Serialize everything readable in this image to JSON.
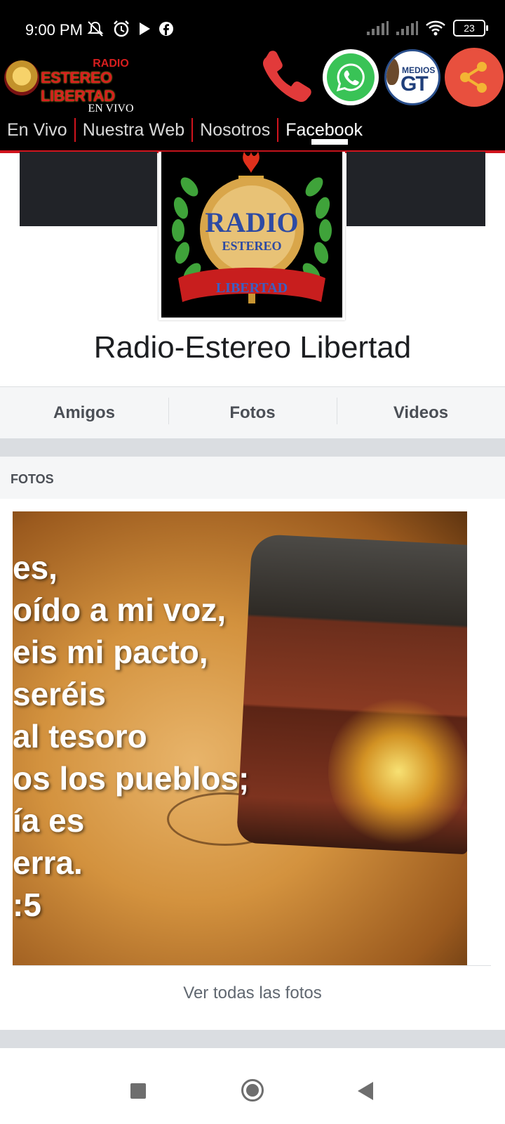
{
  "status_bar": {
    "time": "9:00 PM",
    "battery": "23",
    "icons": [
      "mute-bell-icon",
      "alarm-icon",
      "play-icon",
      "facebook-icon",
      "signal-icon",
      "signal-icon",
      "wifi-icon",
      "battery-icon"
    ]
  },
  "header": {
    "logo": {
      "line1": "RADIO",
      "line2": "ESTEREO LIBERTAD",
      "line3": "EN VIVO"
    },
    "actions": {
      "phone": "phone-icon",
      "whatsapp": "whatsapp-icon",
      "medios_gt": {
        "top": "MEDIOS",
        "main": "GT"
      },
      "share": "share-icon"
    },
    "tabs": [
      {
        "label": "En Vivo"
      },
      {
        "label": "Nuestra Web"
      },
      {
        "label": "Nosotros"
      },
      {
        "label": "Facebook",
        "active": true
      }
    ]
  },
  "profile": {
    "picture_text": {
      "main": "RADIO",
      "sub": "ESTEREO",
      "ribbon": "LIBERTAD"
    },
    "name": "Radio-Estereo Libertad"
  },
  "nav": {
    "items": [
      {
        "label": "Amigos"
      },
      {
        "label": "Fotos"
      },
      {
        "label": "Videos"
      }
    ]
  },
  "fotos": {
    "header": "FOTOS",
    "photo_text": [
      "es,",
      "oído a mi voz,",
      "eis mi pacto,",
      "seréis",
      "al tesoro",
      "os los pueblos;",
      "ía es",
      "erra.",
      ":5"
    ],
    "see_all": "Ver todas las fotos"
  },
  "colors": {
    "header_bg": "#000000",
    "accent_red": "#d0141d",
    "whatsapp_green": "#39c356",
    "share_orange": "#e8503e",
    "nav_text": "#4b4f56"
  }
}
